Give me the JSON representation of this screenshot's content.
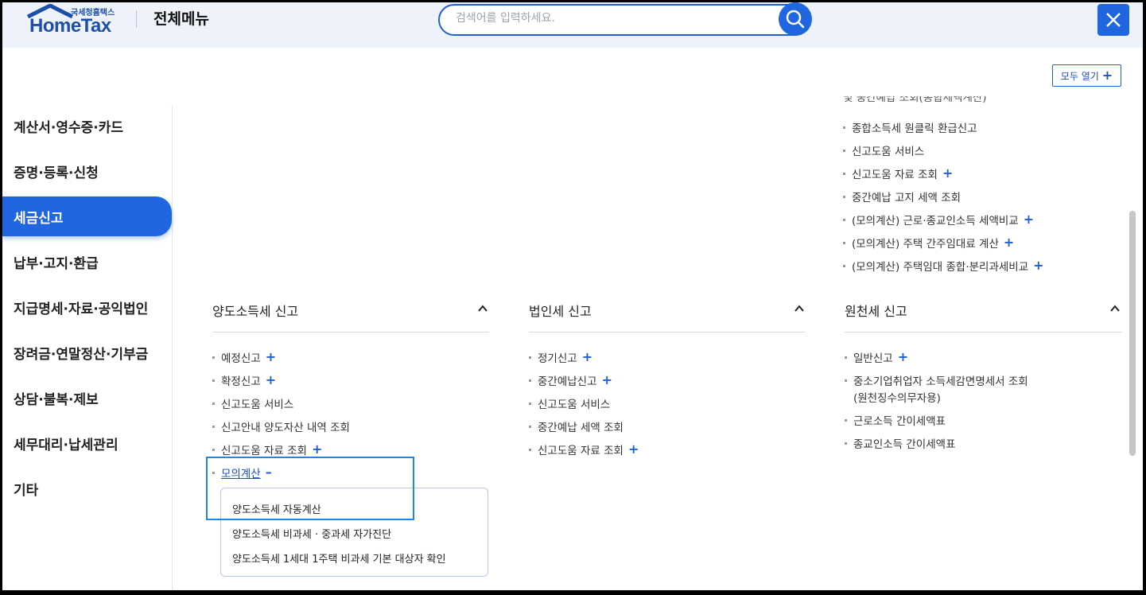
{
  "header": {
    "logo_small": "국세청홈택스",
    "logo_main": "HomeTax",
    "title": "전체메뉴",
    "search_placeholder": "검색어를 입력하세요.",
    "open_all_label": "모두 열기"
  },
  "sidebar": {
    "items": [
      {
        "label": "계산서·영수증·카드",
        "active": false
      },
      {
        "label": "증명·등록·신청",
        "active": false
      },
      {
        "label": "세금신고",
        "active": true
      },
      {
        "label": "납부·고지·환급",
        "active": false
      },
      {
        "label": "지급명세·자료·공익법인",
        "active": false
      },
      {
        "label": "장려금·연말정산·기부금",
        "active": false
      },
      {
        "label": "상담·불복·제보",
        "active": false
      },
      {
        "label": "세무대리·납세관리",
        "active": false
      },
      {
        "label": "기타",
        "active": false
      }
    ]
  },
  "top_right_list": {
    "cut_text": "및 중간예납 조회(종합세액계산)",
    "items": [
      {
        "label": "종합소득세 원클릭 환급신고",
        "expand": false
      },
      {
        "label": "신고도움 서비스",
        "expand": false
      },
      {
        "label": "신고도움 자료 조회",
        "expand": true
      },
      {
        "label": "중간예납 고지 세액 조회",
        "expand": false
      },
      {
        "label": "(모의계산) 근로·종교인소득 세액비교",
        "expand": true
      },
      {
        "label": "(모의계산) 주택 간주임대료 계산",
        "expand": true
      },
      {
        "label": "(모의계산) 주택임대 종합·분리과세비교",
        "expand": true
      }
    ]
  },
  "sections": [
    {
      "title": "양도소득세 신고",
      "items": [
        {
          "label": "예정신고",
          "expand": true
        },
        {
          "label": "확정신고",
          "expand": true
        },
        {
          "label": "신고도움 서비스",
          "expand": false
        },
        {
          "label": "신고안내 양도자산 내역 조회",
          "expand": false
        },
        {
          "label": "신고도움 자료 조회",
          "expand": true
        },
        {
          "label": "모의계산",
          "expanded": true
        }
      ],
      "sub_items": [
        "양도소득세 자동계산",
        "양도소득세 비과세 · 중과세 자가진단",
        "양도소득세 1세대 1주택 비과세 기본 대상자 확인"
      ]
    },
    {
      "title": "법인세 신고",
      "items": [
        {
          "label": "정기신고",
          "expand": true
        },
        {
          "label": "중간예납신고",
          "expand": true
        },
        {
          "label": "신고도움 서비스",
          "expand": false
        },
        {
          "label": "중간예납 세액 조회",
          "expand": false
        },
        {
          "label": "신고도움 자료 조회",
          "expand": true
        }
      ]
    },
    {
      "title": "원천세 신고",
      "items": [
        {
          "label": "일반신고",
          "expand": true
        },
        {
          "label": "중소기업취업자 소득세감면명세서 조회",
          "expand": false
        },
        {
          "label": "(원천징수의무자용)",
          "expand": false
        },
        {
          "label": "근로소득 간이세액표",
          "expand": false
        },
        {
          "label": "종교인소득 간이세액표",
          "expand": false
        }
      ]
    }
  ],
  "colors": {
    "accent": "#1f66e0",
    "highlight": "#1e88e5"
  }
}
